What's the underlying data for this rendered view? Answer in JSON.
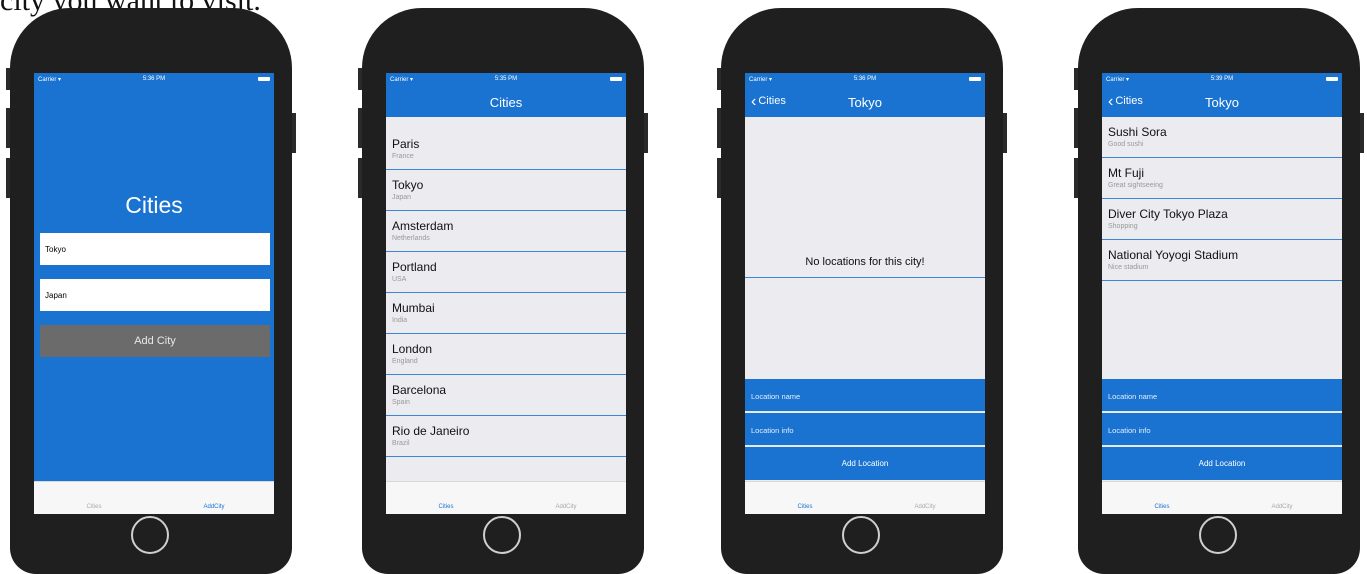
{
  "caption": "city you want to visit.",
  "status": {
    "carrier": "Carrier ▾",
    "times": [
      "5:36 PM",
      "5:35 PM",
      "5:36 PM",
      "5:39 PM"
    ]
  },
  "screen1": {
    "title": "Cities",
    "city_value": "Tokyo",
    "country_value": "Japan",
    "add_button": "Add City"
  },
  "screen2": {
    "nav_title": "Cities",
    "cities": [
      {
        "name": "Paris",
        "country": "France"
      },
      {
        "name": "Tokyo",
        "country": "Japan"
      },
      {
        "name": "Amsterdam",
        "country": "Netherlands"
      },
      {
        "name": "Portland",
        "country": "USA"
      },
      {
        "name": "Mumbai",
        "country": "India"
      },
      {
        "name": "London",
        "country": "England"
      },
      {
        "name": "Barcelona",
        "country": "Spain"
      },
      {
        "name": "Rio de Janeiro",
        "country": "Brazil"
      }
    ]
  },
  "screen3": {
    "back_label": "Cities",
    "nav_title": "Tokyo",
    "empty_message": "No locations for this city!",
    "location_name_placeholder": "Location name",
    "location_info_placeholder": "Location info",
    "add_button": "Add Location"
  },
  "screen4": {
    "back_label": "Cities",
    "nav_title": "Tokyo",
    "locations": [
      {
        "name": "Sushi Sora",
        "info": "Good sushi"
      },
      {
        "name": "Mt Fuji",
        "info": "Great sightseeing"
      },
      {
        "name": "Diver City Tokyo Plaza",
        "info": "Shopping"
      },
      {
        "name": "National Yoyogi Stadium",
        "info": "Nice stadium"
      }
    ],
    "location_name_placeholder": "Location name",
    "location_info_placeholder": "Location info",
    "add_button": "Add Location"
  },
  "tabs": {
    "cities": "Cities",
    "add_city": "AddCity"
  },
  "colors": {
    "accent": "#1a73d1",
    "device": "#1f1f1f",
    "list_bg": "#ebebf0"
  }
}
